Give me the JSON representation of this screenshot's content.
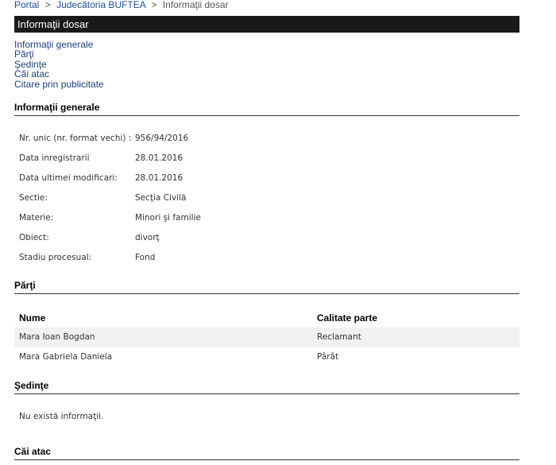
{
  "breadcrumb": {
    "items": [
      "Portal",
      "Judecătoria BUFTEA",
      "Informaţii dosar"
    ],
    "separator": ">"
  },
  "title": "Informaţii dosar",
  "nav_links": [
    "Informaţii generale",
    "Părţi",
    "Şedinţe",
    "Căi atac",
    "Citare prin publicitate"
  ],
  "informatii_generale": {
    "heading": "Informaţii generale",
    "fields": [
      {
        "label": "Nr. unic (nr. format vechi) :",
        "value": "956/94/2016"
      },
      {
        "label": "Data inregistrarii",
        "value": "28.01.2016"
      },
      {
        "label": "Data ultimei modificari:",
        "value": "28.01.2016"
      },
      {
        "label": "Sectie:",
        "value": "Secţia Civilă"
      },
      {
        "label": "Materie:",
        "value": "Minori şi familie"
      },
      {
        "label": "Obiect:",
        "value": "divorţ"
      },
      {
        "label": "Stadiu procesual:",
        "value": "Fond"
      }
    ]
  },
  "parti": {
    "heading": "Părţi",
    "columns": [
      "Nume",
      "Calitate parte"
    ],
    "rows": [
      {
        "nume": "Mara Ioan Bogdan",
        "calitate": "Reclamant"
      },
      {
        "nume": "Mara Gabriela Daniela",
        "calitate": "Pârât"
      }
    ]
  },
  "sedinte": {
    "heading": "Şedinţe",
    "empty_text": "Nu există informaţii."
  },
  "cai_atac": {
    "heading": "Căi atac"
  },
  "colors": {
    "title_bar_bg": "#1a1a1a",
    "link": "#1f3f7a",
    "row_alt_bg": "#f1f1f1"
  }
}
